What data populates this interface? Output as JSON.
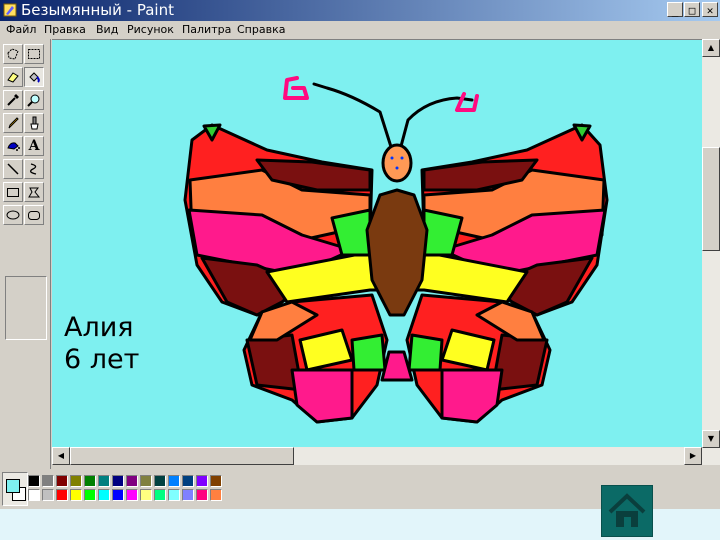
{
  "window": {
    "title": "Безымянный - Paint",
    "app_icon": "paint-brush-icon",
    "controls": {
      "minimize": "_",
      "maximize": "□",
      "close": "✕"
    }
  },
  "menu": {
    "items": [
      {
        "label": "Файл"
      },
      {
        "label": "Правка"
      },
      {
        "label": "Вид"
      },
      {
        "label": "Рисунок"
      },
      {
        "label": "Палитра"
      },
      {
        "label": "Справка"
      }
    ]
  },
  "tools": [
    {
      "name": "free-select-icon"
    },
    {
      "name": "rect-select-icon"
    },
    {
      "name": "eraser-icon"
    },
    {
      "name": "fill-bucket-icon"
    },
    {
      "name": "color-picker-icon"
    },
    {
      "name": "magnifier-icon"
    },
    {
      "name": "pencil-icon"
    },
    {
      "name": "brush-icon"
    },
    {
      "name": "airbrush-icon"
    },
    {
      "name": "text-icon",
      "glyph": "A"
    },
    {
      "name": "line-icon"
    },
    {
      "name": "curve-icon"
    },
    {
      "name": "rectangle-icon"
    },
    {
      "name": "polygon-icon"
    },
    {
      "name": "ellipse-icon"
    },
    {
      "name": "rounded-rect-icon"
    }
  ],
  "canvas": {
    "background": "#7ef0f0",
    "signature": {
      "line1": "Алия",
      "line2": "6 лет"
    }
  },
  "palette": {
    "foreground": "#7ef0f0",
    "background": "#ffffff",
    "colors": [
      "#000000",
      "#808080",
      "#800000",
      "#808000",
      "#008000",
      "#008080",
      "#000080",
      "#800080",
      "#808040",
      "#004040",
      "#0080ff",
      "#004080",
      "#8000ff",
      "#804000",
      "#ffffff",
      "#c0c0c0",
      "#ff0000",
      "#ffff00",
      "#00ff00",
      "#00ffff",
      "#0000ff",
      "#ff00ff",
      "#ffff80",
      "#00ff80",
      "#80ffff",
      "#8080ff",
      "#ff0080",
      "#ff8040"
    ]
  },
  "nav": {
    "home_icon": "home-icon"
  }
}
